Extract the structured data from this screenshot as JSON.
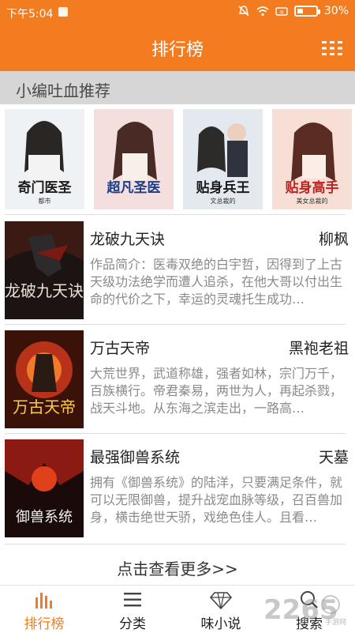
{
  "status_bar": {
    "time": "下午5:04",
    "battery": "30%",
    "battery_level": 0.3
  },
  "header": {
    "title": "排行榜"
  },
  "section": {
    "title": "小编吐血推荐"
  },
  "featured": [
    {
      "caption": "奇门医圣",
      "tag": "都市",
      "bg": "#e8eef2",
      "color": "#1b1b1b"
    },
    {
      "caption": "超凡圣医",
      "tag": "",
      "bg": "#f1d7d7",
      "color": "#1a3d8a"
    },
    {
      "caption": "贴身兵王",
      "tag": "文总裁的",
      "bg": "#dfe6ee",
      "color": "#1a1a1a"
    },
    {
      "caption": "贴身高手",
      "tag": "美女总裁的",
      "bg": "#f5d6cc",
      "color": "#c21f1f"
    }
  ],
  "books": [
    {
      "name": "龙破九天诀",
      "author": "柳枫",
      "desc": "作品简介：医毒双绝的白宇哲，因得到了上古天级功法绝学而遭人追杀，在他大哥以付出生命的代价之下，幸运的灵魂托生成功…",
      "cover_title": "龙破九天诀"
    },
    {
      "name": "万古天帝",
      "author": "黑袍老祖",
      "desc": "大荒世界，武道称雄，强者如林，宗门万千，百族横行。帝君秦易，两世为人，再起杀戮，战天斗地。从东海之滨走出，一路高…",
      "cover_title": "万古天帝"
    },
    {
      "name": "最强御兽系统",
      "author": "天墓",
      "desc": "拥有《御兽系统》的陆洋，只要满足条件，就可以无限御兽，提升战宠血脉等级，召百兽加身，横击绝世天骄，戏绝色佳人。且看…",
      "cover_title": "御兽系统"
    }
  ],
  "more_link": "点击查看更多>>",
  "tabs": [
    {
      "label": "排行榜",
      "icon": "ranking-bars-icon"
    },
    {
      "label": "分类",
      "icon": "list-icon"
    },
    {
      "label": "味小说",
      "icon": "diamond-icon"
    },
    {
      "label": "搜索",
      "icon": "search-icon"
    }
  ],
  "watermark": {
    "text": "2265",
    "sub": "手游网",
    "domain": "com"
  },
  "colors": {
    "accent": "#f27c1f"
  }
}
